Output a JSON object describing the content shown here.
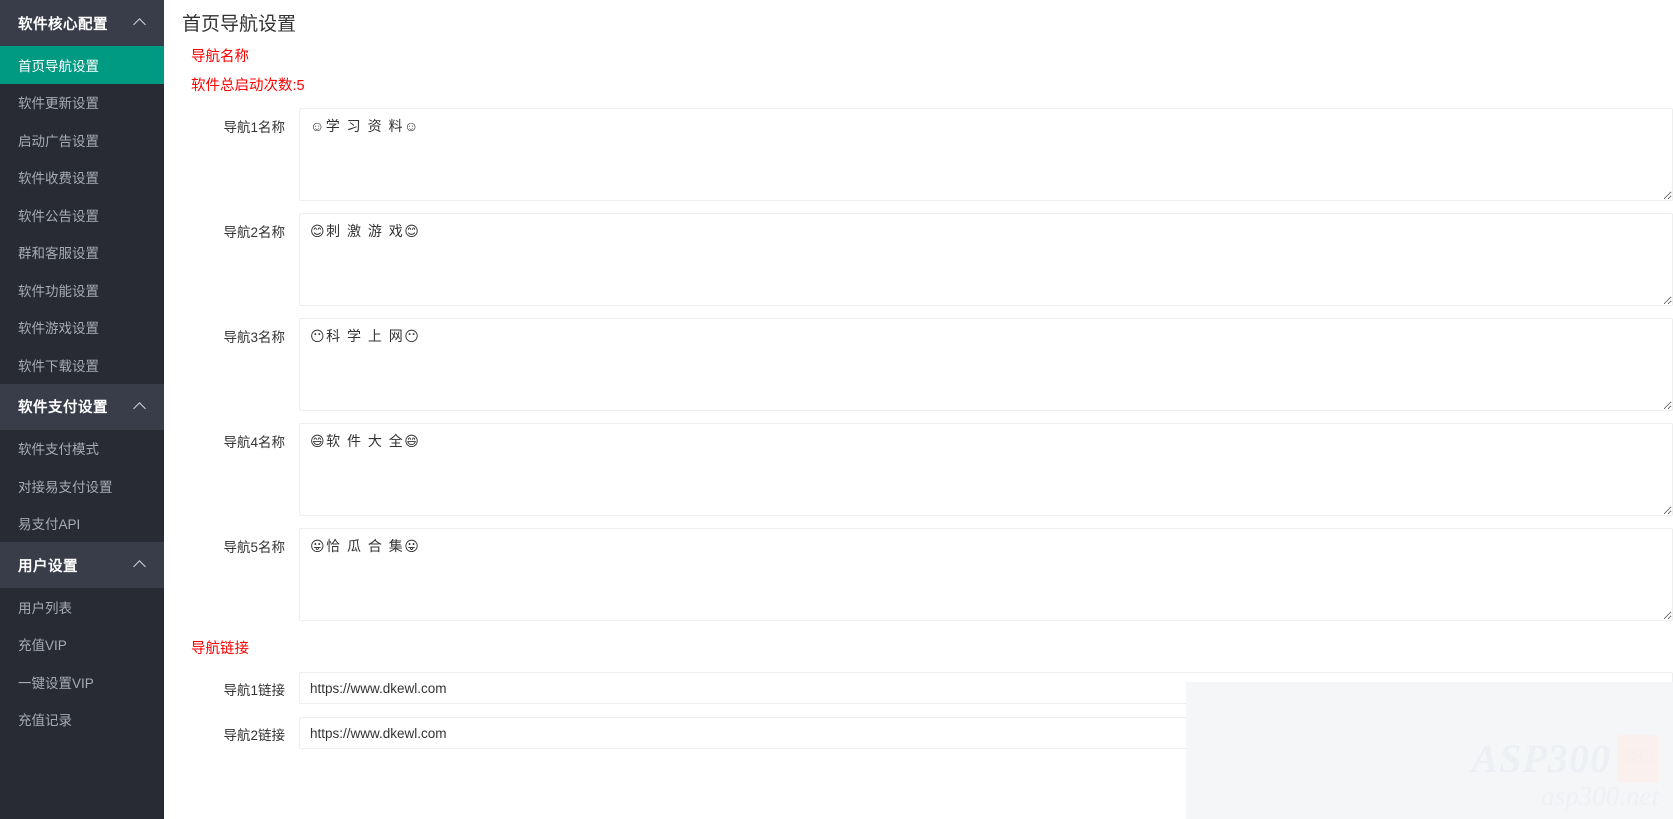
{
  "sidebar": {
    "groups": [
      {
        "label": "软件核心配置",
        "icon": "chevron-up-icon",
        "items": [
          {
            "label": "首页导航设置",
            "active": true
          },
          {
            "label": "软件更新设置",
            "active": false
          },
          {
            "label": "启动广告设置",
            "active": false
          },
          {
            "label": "软件收费设置",
            "active": false
          },
          {
            "label": "软件公告设置",
            "active": false
          },
          {
            "label": "群和客服设置",
            "active": false
          },
          {
            "label": "软件功能设置",
            "active": false
          },
          {
            "label": "软件游戏设置",
            "active": false
          },
          {
            "label": "软件下载设置",
            "active": false
          }
        ]
      },
      {
        "label": "软件支付设置",
        "icon": "chevron-up-icon",
        "items": [
          {
            "label": "软件支付模式",
            "active": false
          },
          {
            "label": "对接易支付设置",
            "active": false
          },
          {
            "label": "易支付API",
            "active": false
          }
        ]
      },
      {
        "label": "用户设置",
        "icon": "chevron-up-icon",
        "items": [
          {
            "label": "用户列表",
            "active": false
          },
          {
            "label": "充值VIP",
            "active": false
          },
          {
            "label": "一键设置VIP",
            "active": false
          },
          {
            "label": "充值记录",
            "active": false
          }
        ]
      }
    ]
  },
  "main": {
    "page_title": "首页导航设置",
    "names_section": {
      "title": "导航名称",
      "launch_count_text": "软件总启动次数:5",
      "rows": [
        {
          "label": "导航1名称",
          "value": "☺学 习 资 料☺"
        },
        {
          "label": "导航2名称",
          "value": "😊刺 激 游 戏😊"
        },
        {
          "label": "导航3名称",
          "value": "😶科 学 上 网😶"
        },
        {
          "label": "导航4名称",
          "value": "😄软 件 大 全😄"
        },
        {
          "label": "导航5名称",
          "value": "😛恰 瓜 合 集😛"
        }
      ]
    },
    "links_section": {
      "title": "导航链接",
      "rows": [
        {
          "label": "导航1链接",
          "value": "https://www.dkewl.com"
        },
        {
          "label": "导航2链接",
          "value": "https://www.dkewl.com"
        }
      ]
    }
  },
  "watermark": {
    "main_text": "ASP300",
    "badge_text": "源码",
    "sub_text": "asp300.net"
  },
  "colors": {
    "accent": "#009982",
    "sidebar_bg": "#282b33",
    "sidebar_group_bg": "#393d4a",
    "label_red": "#ff0000"
  }
}
